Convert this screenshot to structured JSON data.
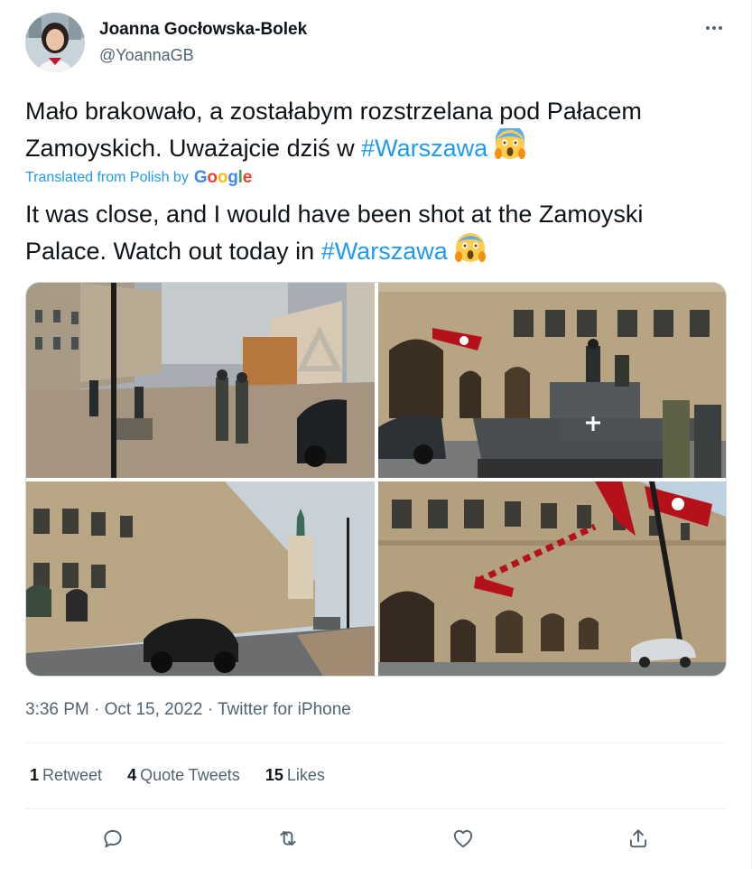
{
  "author": {
    "name": "Joanna Gocłowska-Bolek",
    "handle": "@YoannaGB"
  },
  "tweet": {
    "original_before": "Mało brakowało, a zostałabym rozstrzelana pod Pałacem Zamoyskich. Uważajcie dziś w ",
    "original_hashtag": "#Warszawa",
    "translated_label": "Translated from Polish by",
    "translator": "Google",
    "translation_before": "It was close, and I would have been shot at the Zamoyski Palace. Watch out today in ",
    "translation_hashtag": "#Warszawa",
    "emoji": "face-screaming-in-fear"
  },
  "meta": {
    "time": "3:36 PM",
    "date": "Oct 15, 2022",
    "source": "Twitter for iPhone",
    "separator": "·"
  },
  "stats": [
    {
      "count": "1",
      "label": "Retweet"
    },
    {
      "count": "4",
      "label": "Quote Tweets"
    },
    {
      "count": "15",
      "label": "Likes"
    }
  ],
  "colors": {
    "link": "#1d9bf0",
    "secondary_text": "#536471",
    "primary_text": "#0f1419",
    "divider": "#eff3f4"
  },
  "icons": [
    "more-icon",
    "reply-icon",
    "retweet-icon",
    "like-icon",
    "share-icon"
  ]
}
